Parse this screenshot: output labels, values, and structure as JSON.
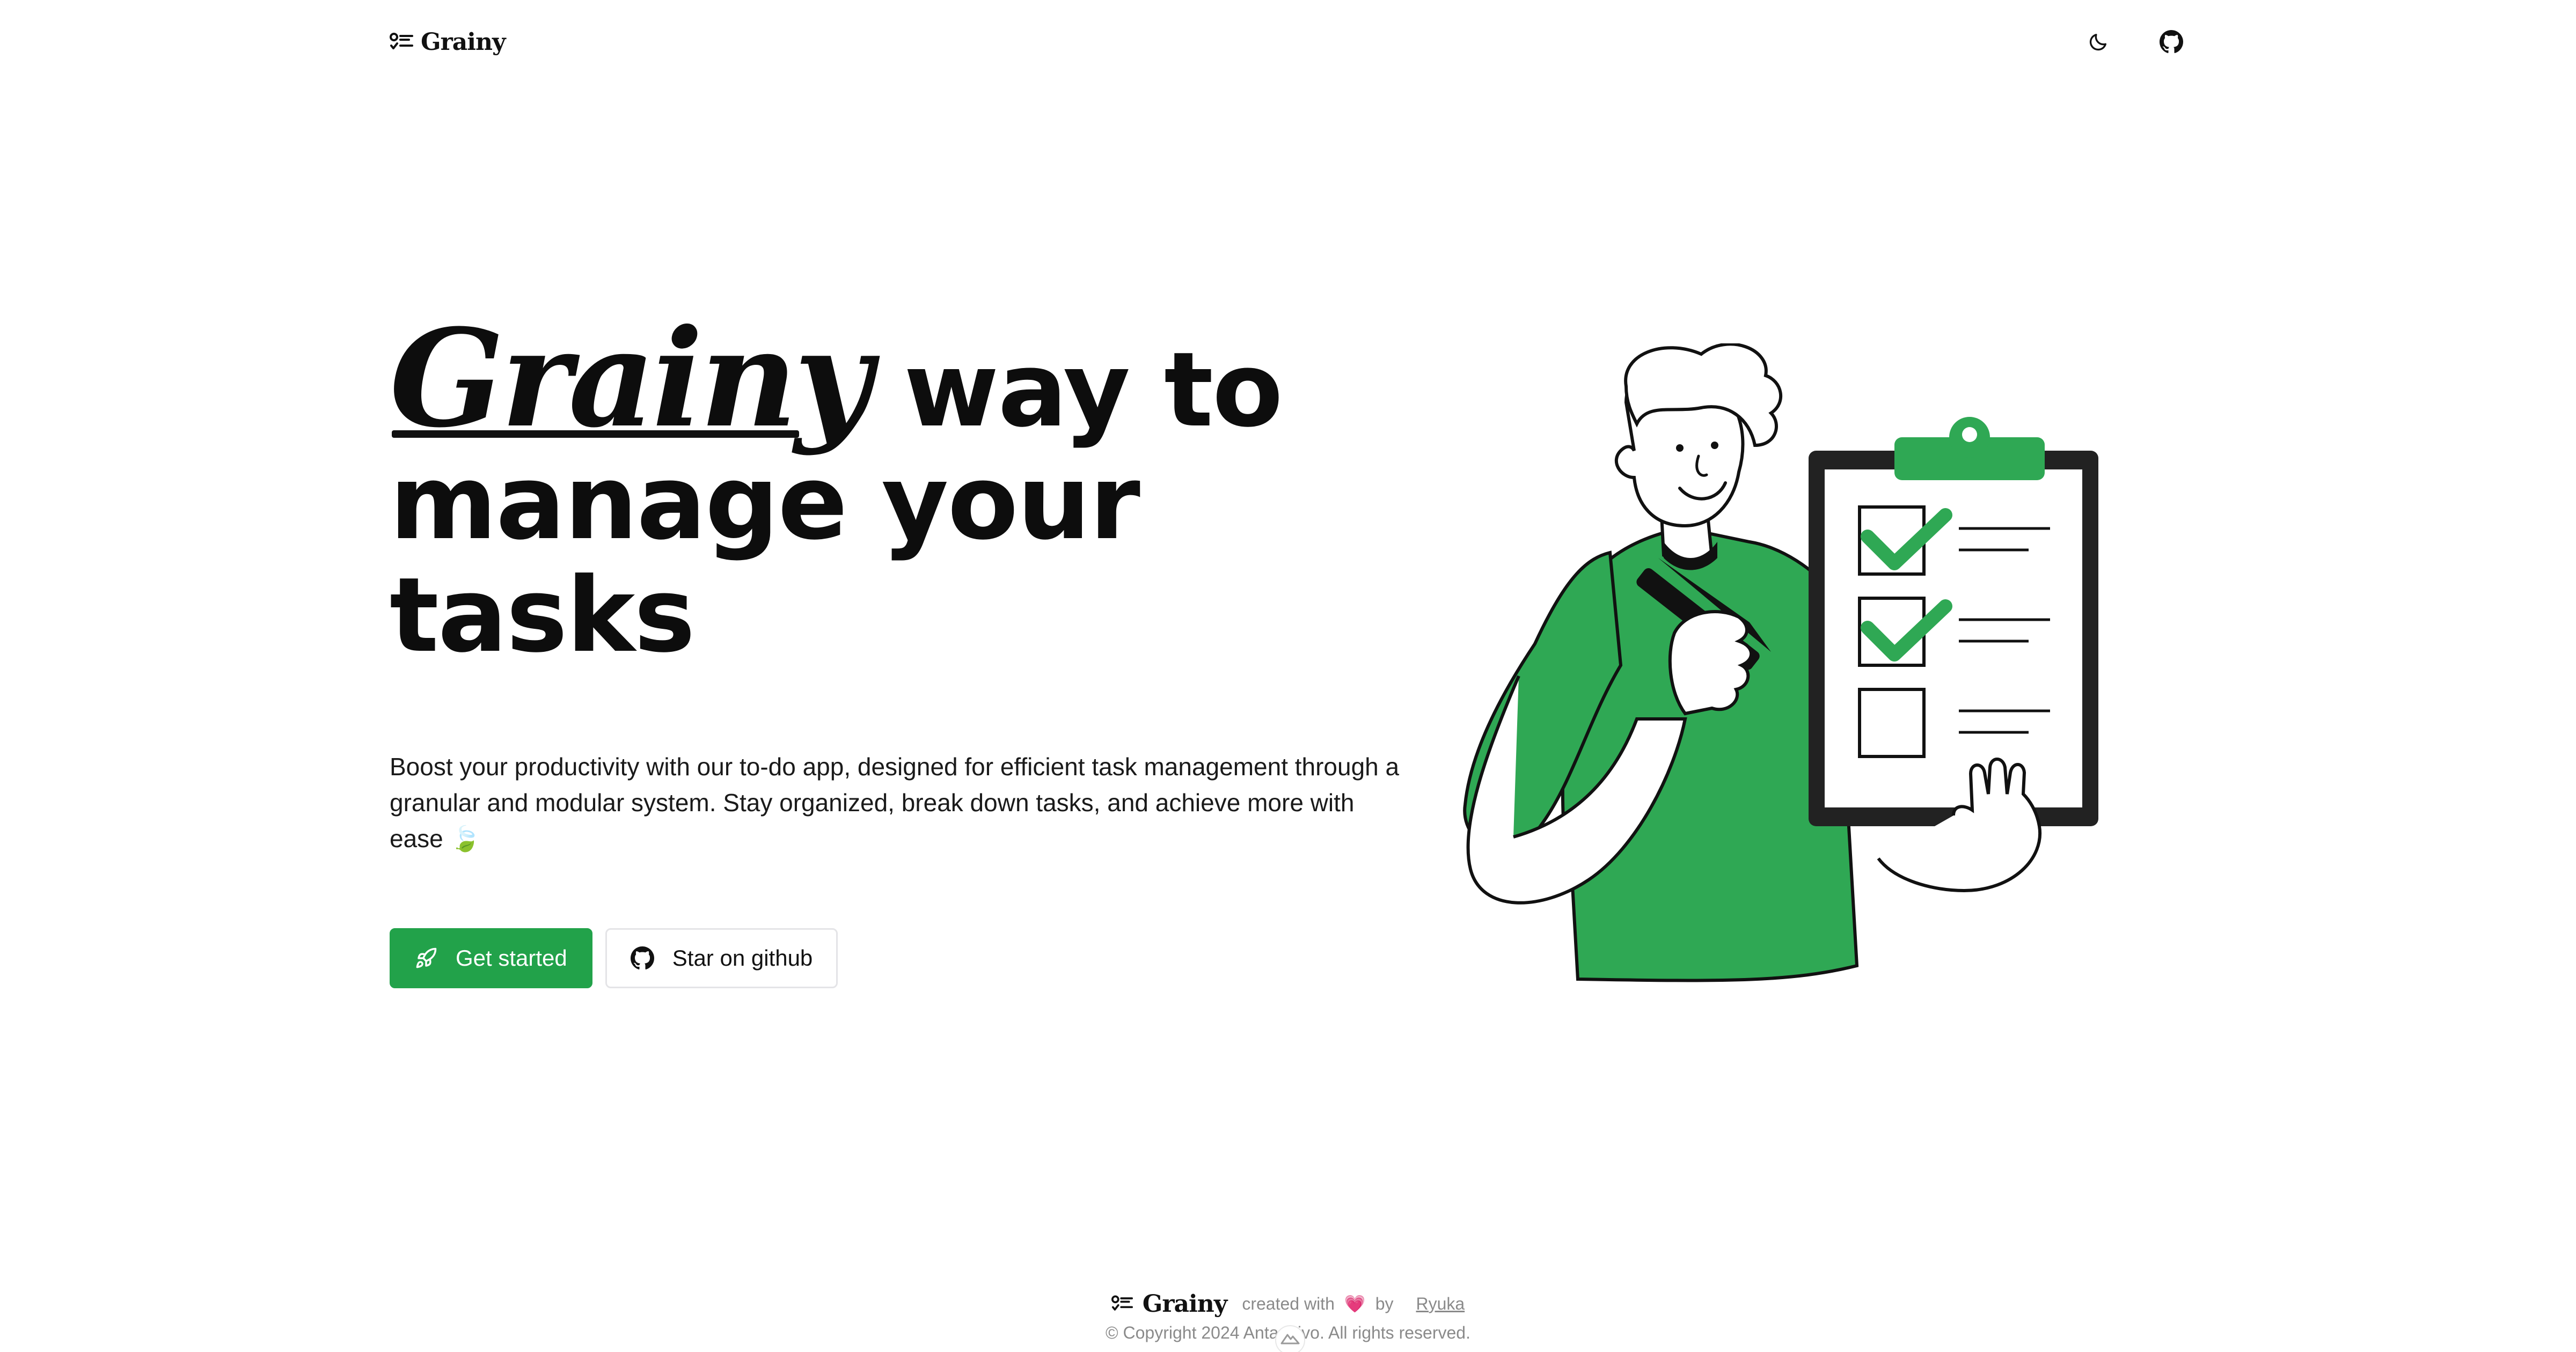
{
  "header": {
    "logo_text": "Grainy",
    "logo_icon": "list-check-icon",
    "theme_toggle_icon": "moon-icon",
    "github_icon": "github-icon"
  },
  "hero": {
    "title_brand": "Grainy",
    "title_rest_line1": " way to",
    "title_line2": "manage your",
    "title_line3": "tasks",
    "description": "Boost your productivity with our to-do app, designed for efficient task management through a granular and modular system. Stay organized, break down tasks, and achieve more with ease 🍃",
    "primary_button": {
      "label": "Get started",
      "icon": "rocket-icon"
    },
    "secondary_button": {
      "label": "Star on github",
      "icon": "github-icon"
    }
  },
  "illustration": {
    "subject": "person-with-checklist-illustration"
  },
  "footer": {
    "logo_text": "Grainy",
    "created_with": "created with",
    "heart": "💗",
    "by": "by",
    "author": "Ryuka",
    "copyright": "© Copyright 2024 Antarctivo. All rights reserved."
  },
  "colors": {
    "accent": "#22a24a",
    "text": "#111111",
    "muted": "#8a8a8a",
    "border": "#e4e4e7"
  }
}
